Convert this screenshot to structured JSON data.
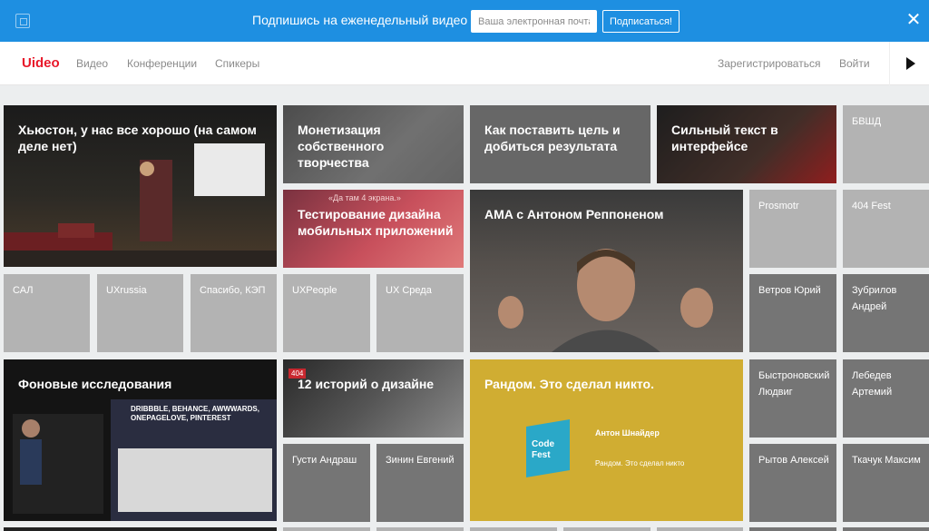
{
  "promo": {
    "text": "Подпишись на еженедельный видео сок",
    "email_placeholder": "Ваша электронная почта",
    "subscribe_label": "Подписаться!",
    "close_glyph": "✕"
  },
  "header": {
    "logo": "Uideo",
    "nav": [
      "Видео",
      "Конференции",
      "Спикеры"
    ],
    "register": "Зарегистрироваться",
    "login": "Войти"
  },
  "colors": {
    "promo_bg": "#1e8fe1",
    "logo": "#e8182a",
    "tile_light": "#b3b3b3",
    "tile_dark": "#757575"
  },
  "videos": {
    "houston": "Хьюстон, у нас все хорошо (на самом деле нет)",
    "monetization": "Монетизация собственного творчества",
    "goal": "Как поставить цель и добиться результата",
    "strong_text": "Сильный текст в интерфейсе",
    "mobile_testing": "Тестирование дизайна мобильных приложений",
    "ama": "AMA с Антоном Реппоненом",
    "background_research": "Фоновые исследования",
    "twelve_stories": "12 историй о дизайне",
    "random": "Рандом. Это сделал никто."
  },
  "tags": {
    "bvshd": "БВШД",
    "prosmotr": "Prosmotr",
    "fest404": "404 Fest",
    "sal": "САЛ",
    "uxrussia": "UXrussia",
    "spasibo": "Спасибо, КЭП",
    "uxpeople": "UXPeople",
    "uxsreda": "UX Среда"
  },
  "speakers": {
    "vetrov": "Ветров Юрий",
    "zubrilov": "Зубрилов Андрей",
    "bystronovsky": "Быстроновский Людвиг",
    "lebedev": "Лебедев Артемий",
    "gusti": "Густи Андраш",
    "zinin": "Зинин Евгений",
    "rytov": "Рытов Алексей",
    "tkachuk": "Ткачук Максим"
  },
  "thumb_text": {
    "screens": "«Да там 4 экрана.»",
    "badge404": "404",
    "dribbble": "DRIBBBLE, BEHANCE, AWWWARDS, ONEPAGELOVE, PINTEREST",
    "codefest_logo": "Code Fest",
    "random_speaker": "Антон Шнайдер",
    "random_talk": "Рандом. Это сделал никто"
  }
}
